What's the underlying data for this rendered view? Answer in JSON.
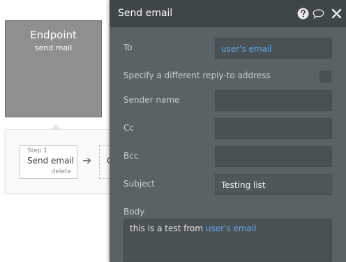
{
  "endpoint": {
    "title": "Endpoint",
    "subtitle": "send mail"
  },
  "workflow": {
    "step": {
      "number": "Step 1",
      "name": "Send email",
      "delete_label": "delete"
    },
    "next_step_partial": "C"
  },
  "panel": {
    "title": "Send email",
    "icons": {
      "help": "help-icon",
      "comment": "comment-icon",
      "close": "close-icon"
    },
    "fields": {
      "to": {
        "label": "To",
        "value": "user's email"
      },
      "reply_to": {
        "label": "Specify a different reply-to address",
        "checked": false
      },
      "sender_name": {
        "label": "Sender name",
        "value": ""
      },
      "cc": {
        "label": "Cc",
        "value": ""
      },
      "bcc": {
        "label": "Bcc",
        "value": ""
      },
      "subject": {
        "label": "Subject",
        "value": "Testing list"
      },
      "body": {
        "label": "Body",
        "text_prefix": "this is a test from ",
        "dynamic_value": "user's email"
      }
    }
  },
  "colors": {
    "dynamic_link": "#5cabf3",
    "panel_bg": "#5a6266",
    "header_bg": "#3f4649"
  }
}
